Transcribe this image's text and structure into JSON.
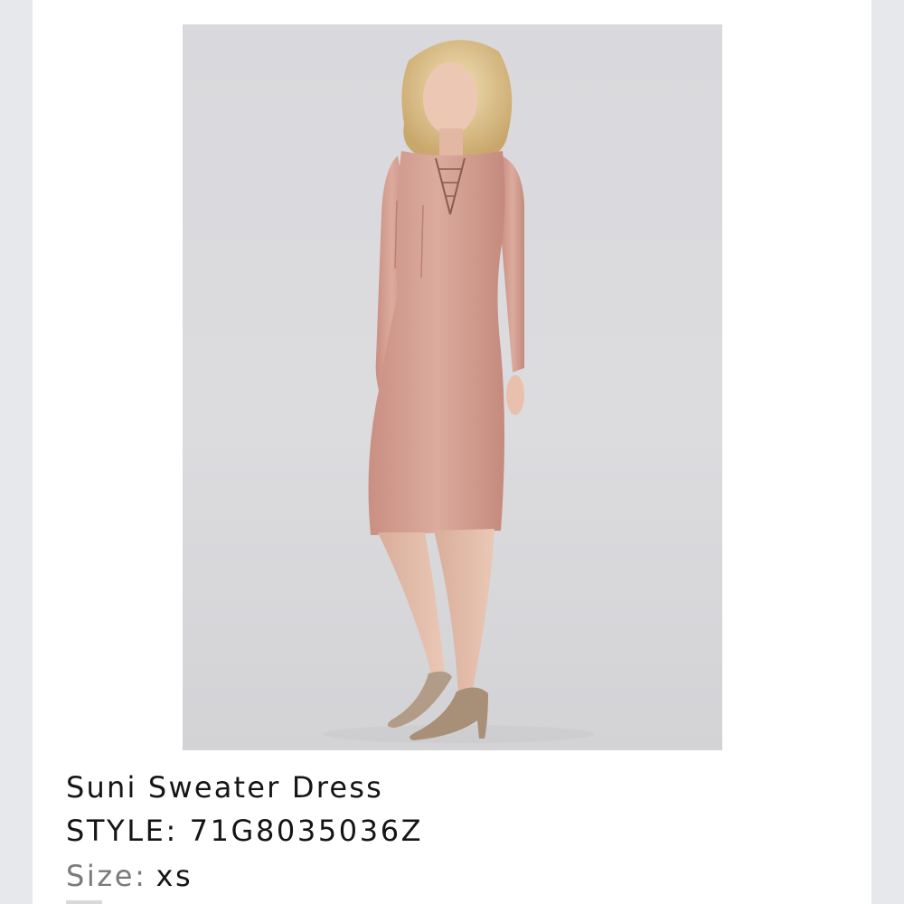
{
  "product": {
    "name": "Suni Sweater Dress",
    "style_label": "STYLE:",
    "style_value": "71G8035036Z",
    "size_label": "Size:",
    "size_value": "xs"
  },
  "image": {
    "subject": "model-photo",
    "colors": {
      "background": "#d9d9dd",
      "dress": "#d9a69a",
      "shoes": "#b39c87",
      "hair": "#e8d3a4"
    }
  }
}
